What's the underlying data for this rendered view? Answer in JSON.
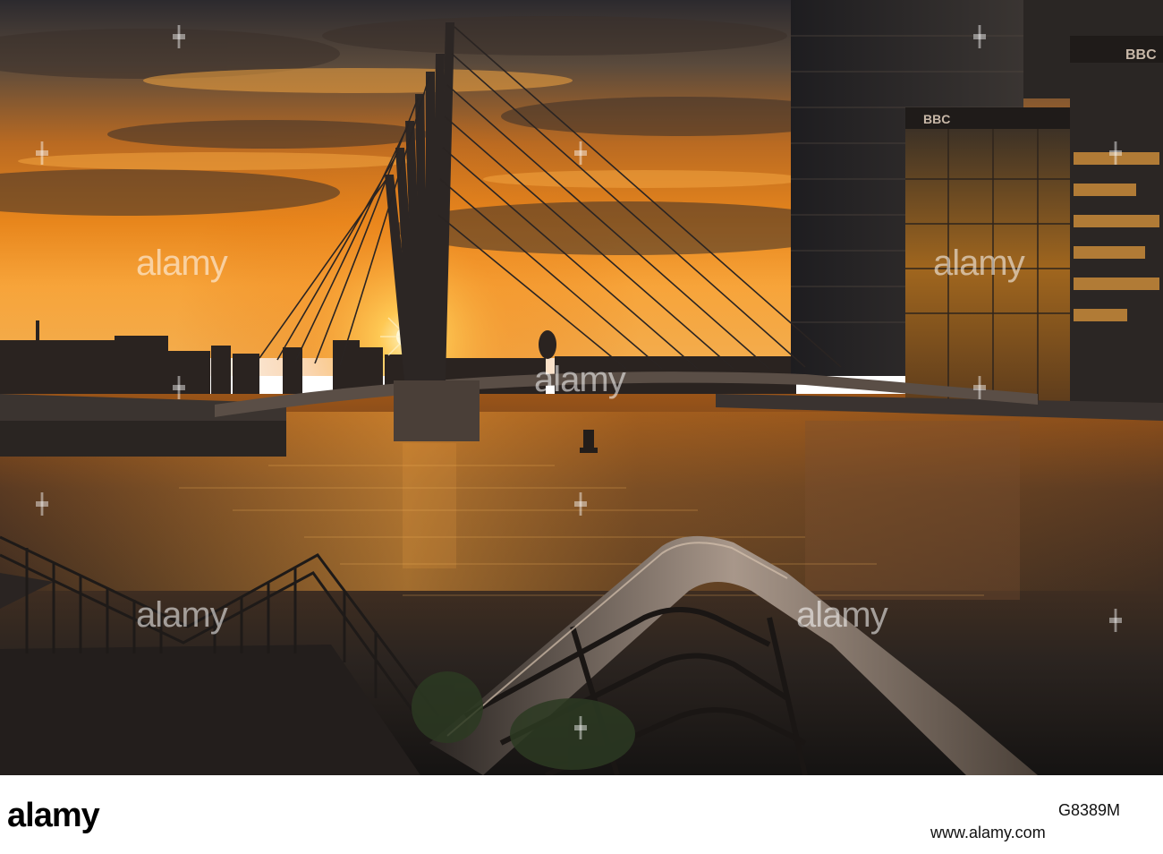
{
  "watermark": {
    "text": "alamy"
  },
  "signs": {
    "bbc_label": "BBC"
  },
  "footer": {
    "logo_text": "alamy",
    "image_id": "G8389M",
    "credit": "www.alamy.com"
  }
}
